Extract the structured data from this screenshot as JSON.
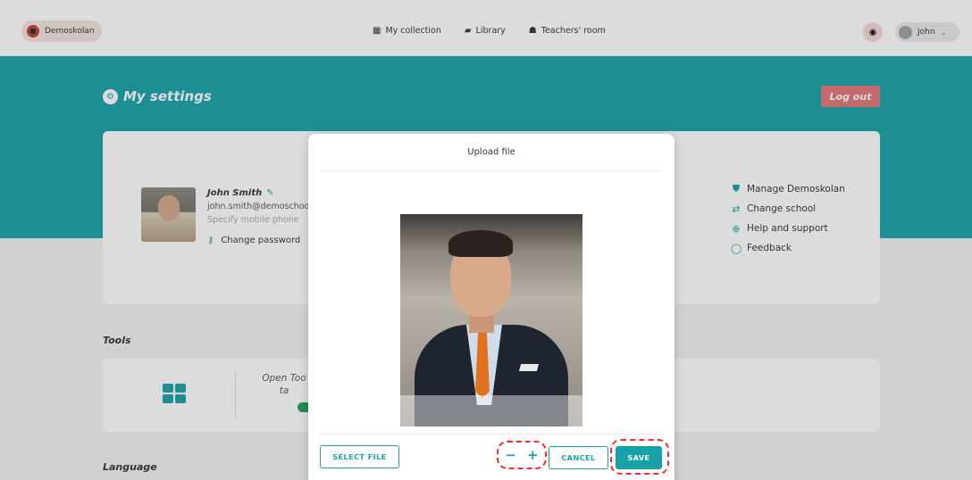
{
  "nav": {
    "school": "Demoskolan",
    "links": [
      {
        "label": "My collection",
        "icon": "grid-icon"
      },
      {
        "label": "Library",
        "icon": "book-icon"
      },
      {
        "label": "Teachers' room",
        "icon": "people-icon"
      }
    ],
    "user_name": "John",
    "user_icon": "chevron-down-icon"
  },
  "header": {
    "title": "My settings",
    "logout_label": "Log out"
  },
  "profile": {
    "name": "John Smith",
    "email": "john.smith@demoschoo",
    "phone_placeholder": "Specify mobile phone",
    "change_password": "Change password",
    "links": [
      {
        "label": "Manage Demoskolan",
        "icon": "shield-icon"
      },
      {
        "label": "Change school",
        "icon": "swap-icon"
      },
      {
        "label": "Help and support",
        "icon": "lifebuoy-icon"
      },
      {
        "label": "Feedback",
        "icon": "speech-bubble-icon"
      }
    ]
  },
  "tools": {
    "title": "Tools",
    "open_tools_text": "Open Too ta"
  },
  "language": {
    "title": "Language"
  },
  "modal": {
    "title": "Upload file",
    "select_file_label": "SELECT FILE",
    "zoom_out_label": "−",
    "zoom_in_label": "+",
    "cancel_label": "CANCEL",
    "save_label": "SAVE"
  },
  "colors": {
    "accent": "#17a2a8",
    "logout": "#e07575",
    "highlight": "#ff2b1a"
  }
}
